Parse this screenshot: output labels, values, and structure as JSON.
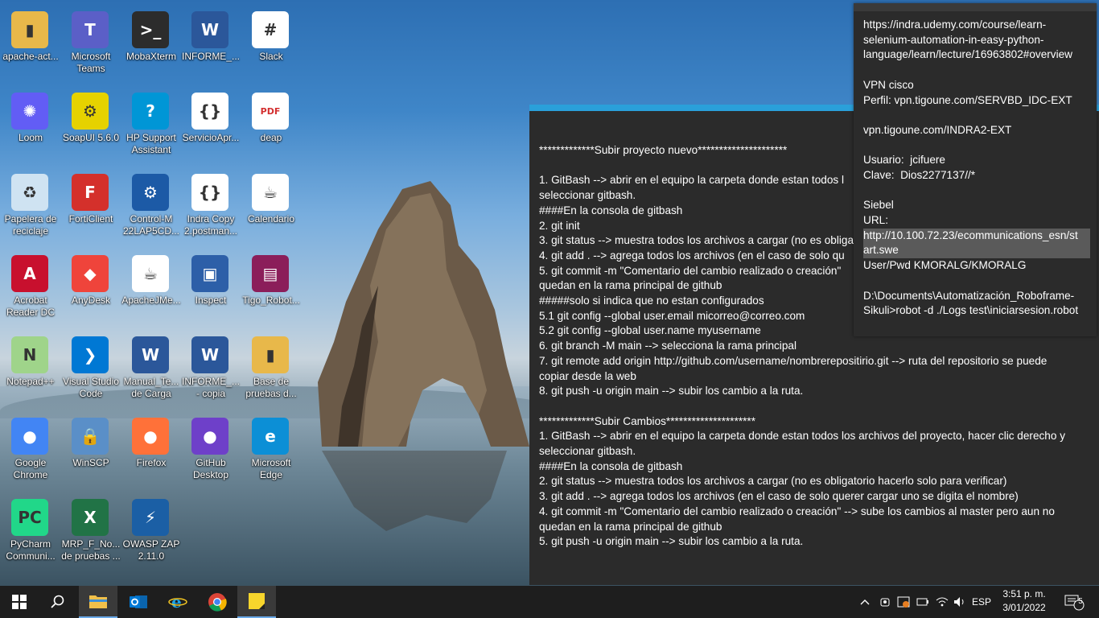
{
  "desktop": {
    "icons": [
      {
        "label": "apache-act...",
        "icon": "folder-icon",
        "color": "#e8b84a"
      },
      {
        "label": "Microsoft Teams",
        "icon": "teams-icon",
        "color": "#5b5fc7"
      },
      {
        "label": "MobaXterm",
        "icon": "terminal-icon",
        "color": "#2c2c2c"
      },
      {
        "label": "INFORME_...",
        "icon": "word-icon",
        "color": "#2b579a"
      },
      {
        "label": "Slack",
        "icon": "slack-icon",
        "color": "#ffffff"
      },
      {
        "label": "Loom",
        "icon": "loom-icon",
        "color": "#625df5"
      },
      {
        "label": "SoapUI 5.6.0",
        "icon": "soapui-icon",
        "color": "#e6d200"
      },
      {
        "label": "HP Support Assistant",
        "icon": "help-icon",
        "color": "#0096d6"
      },
      {
        "label": "ServicioApr...",
        "icon": "json-file-icon",
        "color": "#ffffff"
      },
      {
        "label": "deap",
        "icon": "pdf-icon",
        "color": "#ffffff"
      },
      {
        "label": "Papelera de reciclaje",
        "icon": "recycle-bin-icon",
        "color": "#cfe3f2"
      },
      {
        "label": "FortiClient",
        "icon": "forticlient-icon",
        "color": "#d4302b"
      },
      {
        "label": "Control-M 22LAP5CD...",
        "icon": "control-m-icon",
        "color": "#1c5aa6"
      },
      {
        "label": "Indra Copy 2.postman...",
        "icon": "json-file-icon",
        "color": "#ffffff"
      },
      {
        "label": "Calendario",
        "icon": "java-file-icon",
        "color": "#ffffff"
      },
      {
        "label": "Acrobat Reader DC",
        "icon": "acrobat-icon",
        "color": "#c8102e"
      },
      {
        "label": "AnyDesk",
        "icon": "anydesk-icon",
        "color": "#ef443b"
      },
      {
        "label": "ApacheJMe...",
        "icon": "java-icon",
        "color": "#ffffff"
      },
      {
        "label": "Inspect",
        "icon": "inspect-icon",
        "color": "#2d5fa8"
      },
      {
        "label": "Tigo_Robot...",
        "icon": "winrar-icon",
        "color": "#8b1e5a"
      },
      {
        "label": "Notepad++",
        "icon": "notepadpp-icon",
        "color": "#9fd48a"
      },
      {
        "label": "Visual Studio Code",
        "icon": "vscode-icon",
        "color": "#0078d4"
      },
      {
        "label": "Manual_Te... de Carga",
        "icon": "word-icon",
        "color": "#2b579a"
      },
      {
        "label": "INFORME_... - copia",
        "icon": "word-icon",
        "color": "#2b579a"
      },
      {
        "label": "Base de pruebas d...",
        "icon": "folder-icon",
        "color": "#e8b84a"
      },
      {
        "label": "Google Chrome",
        "icon": "chrome-icon",
        "color": "#4285f4"
      },
      {
        "label": "WinSCP",
        "icon": "winscp-icon",
        "color": "#5a8fc8"
      },
      {
        "label": "Firefox",
        "icon": "firefox-icon",
        "color": "#ff7139"
      },
      {
        "label": "GitHub Desktop",
        "icon": "github-icon",
        "color": "#6e40c9"
      },
      {
        "label": "Microsoft Edge",
        "icon": "edge-icon",
        "color": "#0c8fd6"
      },
      {
        "label": "PyCharm Communi...",
        "icon": "pycharm-icon",
        "color": "#21d789"
      },
      {
        "label": "MRP_F_No... de pruebas ...",
        "icon": "excel-icon",
        "color": "#217346"
      },
      {
        "label": "OWASP ZAP 2.11.0",
        "icon": "zap-icon",
        "color": "#1b5fa5"
      }
    ]
  },
  "note_main": {
    "lines": [
      "*************Subir proyecto nuevo*********************",
      "",
      "1. GitBash --> abrir en el equipo la carpeta donde estan todos l",
      "seleccionar gitbash.",
      "####En la consola de gitbash",
      "2. git init",
      "3. git status --> muestra todos los archivos a cargar (no es obliga",
      "4. git add . --> agrega todos los archivos (en el caso de solo qu",
      "5. git commit -m \"Comentario del cambio realizado o creación\"",
      "quedan en la rama principal de github",
      "#####solo si indica que no estan configurados",
      "5.1 git config --global user.email micorreo@correo.com",
      "5.2 git config --global user.name myusername",
      "6. git branch -M main --> selecciona la rama principal",
      "7. git remote add origin http://github.com/username/nombrerepositirio.git --> ruta del repositorio se puede",
      "copiar desde la web",
      "8. git push -u origin main --> subir los cambio a la ruta.",
      "",
      "*************Subir Cambios*********************",
      "1. GitBash --> abrir en el equipo la carpeta donde estan todos los archivos del proyecto, hacer clic derecho y",
      "seleccionar gitbash.",
      "####En la consola de gitbash",
      "2. git status --> muestra todos los archivos a cargar (no es obligatorio hacerlo solo para verificar)",
      "3. git add . --> agrega todos los archivos (en el caso de solo querer cargar uno se digita el nombre)",
      "4. git commit -m \"Comentario del cambio realizado o creación\" --> sube los cambios al master pero aun no",
      "quedan en la rama principal de github",
      "5. git push -u origin main --> subir los cambio a la ruta."
    ]
  },
  "note_top": {
    "lines": [
      "https://indra.udemy.com/course/learn-",
      "selenium-automation-in-easy-python-",
      "language/learn/lecture/16963802#overview",
      "",
      "VPN cisco",
      "Perfil: vpn.tigoune.com/SERVBD_IDC-EXT",
      "",
      "vpn.tigoune.com/INDRA2-EXT",
      "",
      "Usuario:  jcifuere",
      "Clave:  Dios2277137//*",
      "",
      "Siebel",
      "URL:",
      "http://10.100.72.23/ecommunications_esn/st",
      "art.swe",
      "User/Pwd KMORALG/KMORALG",
      "",
      "D:\\Documents\\Automatización_Roboframe-",
      "Sikuli>robot -d ./Logs test\\iniciarsesion.robot"
    ]
  },
  "taskbar": {
    "apps": [
      {
        "name": "start-button",
        "icon": "windows-icon"
      },
      {
        "name": "search-button",
        "icon": "search-icon"
      },
      {
        "name": "file-explorer-button",
        "icon": "folder-icon"
      },
      {
        "name": "outlook-button",
        "icon": "outlook-icon"
      },
      {
        "name": "ie-button",
        "icon": "ie-icon"
      },
      {
        "name": "chrome-button",
        "icon": "chrome-icon"
      },
      {
        "name": "sticky-notes-button",
        "icon": "sticky-notes-icon"
      }
    ],
    "language": "ESP",
    "time": "3:51 p. m.",
    "date": "3/01/2022",
    "notifications": "5"
  }
}
